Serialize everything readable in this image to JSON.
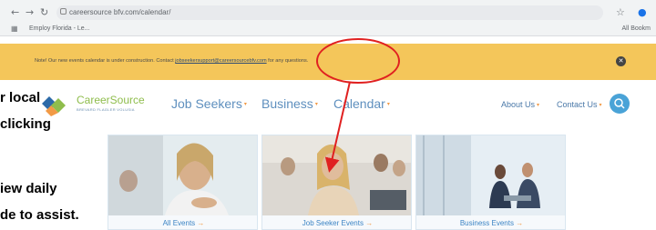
{
  "browser": {
    "url": "careersource bfv.com/calendar/",
    "bookmark": "Employ Florida - Le...",
    "all_bookmarks": "All Bookm"
  },
  "banner": {
    "text_before": "Note! Our new events calendar is under construction. Contact ",
    "email": "jobseekersupport@careersourcebfv.com",
    "text_after": " for any questions."
  },
  "logo": {
    "name": "CareerSource",
    "subtitle": "BREVARD FLAGLER VOLUSIA"
  },
  "nav": {
    "job_seekers": "Job Seekers",
    "business": "Business",
    "calendar": "Calendar",
    "about": "About Us",
    "contact": "Contact Us"
  },
  "overlay_text": {
    "line1": "r local",
    "line2": "clicking",
    "line3": "iew daily",
    "line4": "de to assist."
  },
  "cards": [
    {
      "label": "All Events"
    },
    {
      "label": "Job Seeker Events"
    },
    {
      "label": "Business Events"
    }
  ],
  "colors": {
    "banner": "#f4c65a",
    "nav_blue": "#5e8fbe",
    "accent_orange": "#f29a45",
    "annotation_red": "#e02020"
  }
}
